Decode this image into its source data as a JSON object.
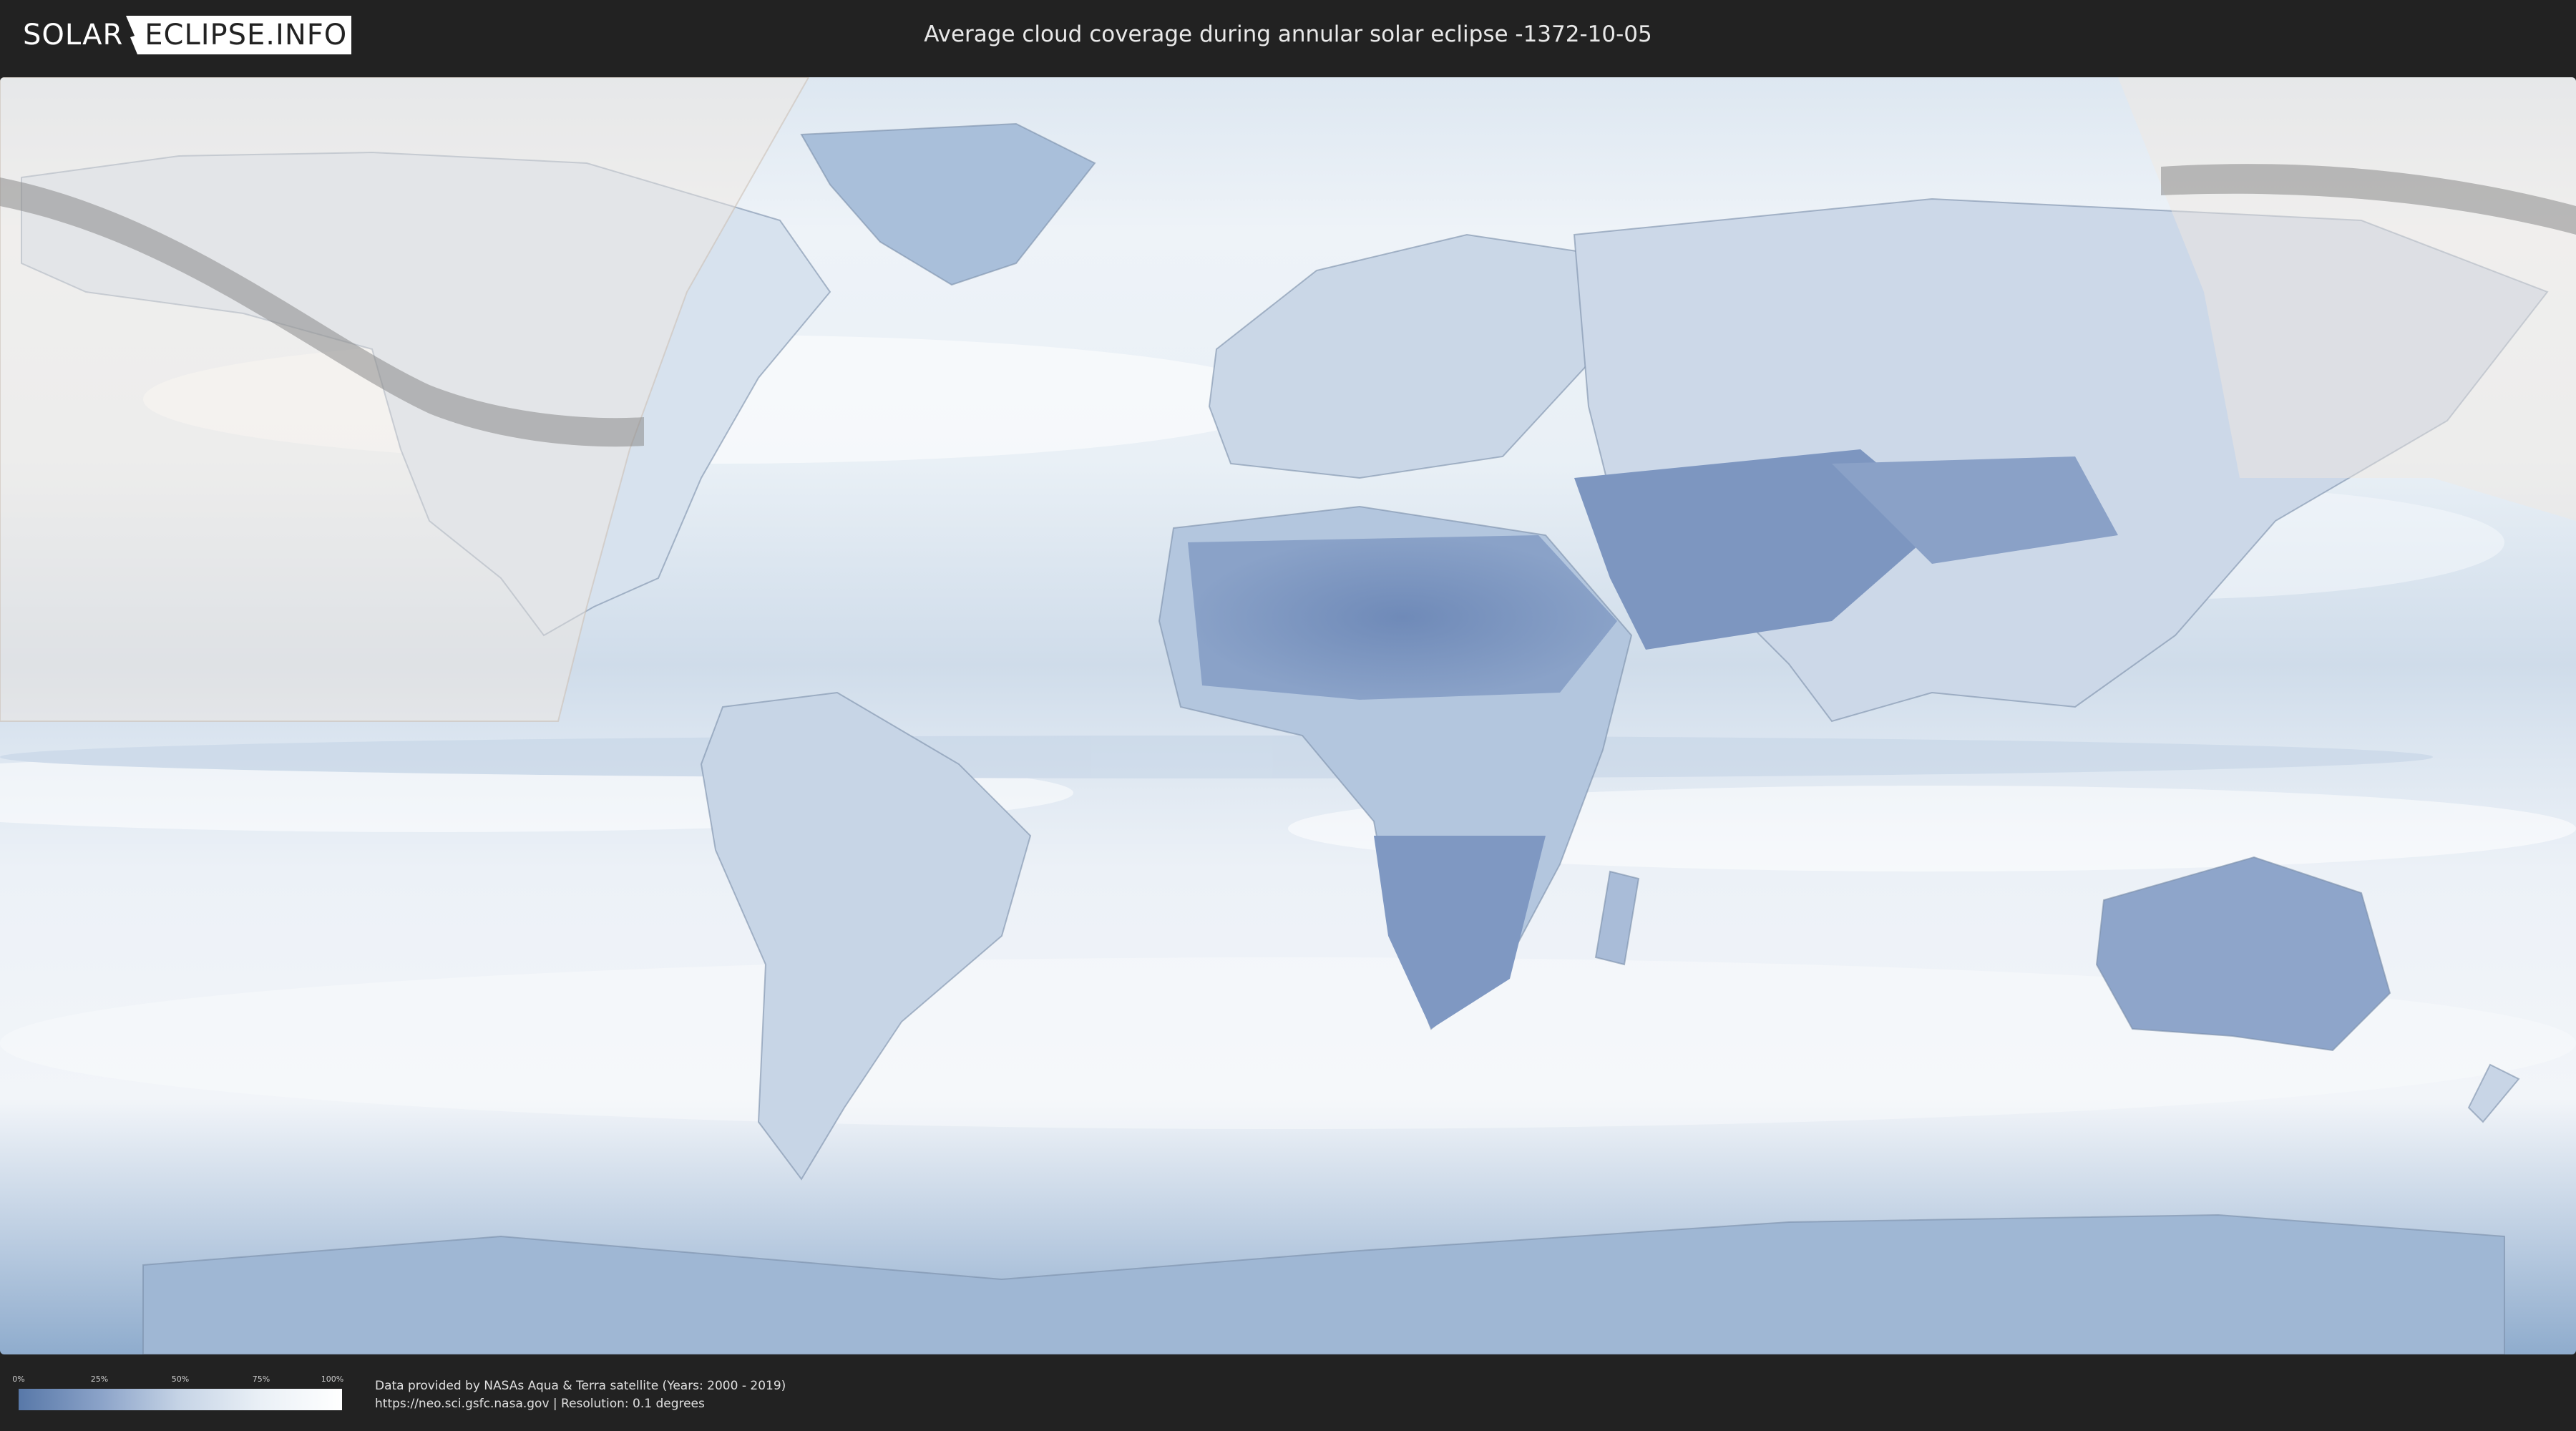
{
  "header": {
    "logo_part1": "SOLAR",
    "logo_part2": "ECLIPSE.INFO",
    "title": "Average cloud coverage during annular solar eclipse -1372-10-05"
  },
  "legend": {
    "ticks": [
      "0%",
      "25%",
      "50%",
      "75%",
      "100%"
    ],
    "scale_values": [
      0,
      25,
      50,
      75,
      100
    ],
    "gradient_colors": [
      "#5878a8",
      "#8aa2c8",
      "#c6d4e6",
      "#eaf0f6",
      "#ffffff"
    ]
  },
  "credits": {
    "line1": "Data provided by NASAs Aqua & Terra satellite (Years: 2000 - 2019)",
    "line2": "https://neo.sci.gsfc.nasa.gov | Resolution: 0.1 degrees"
  },
  "map": {
    "icons": [
      "world-map",
      "eclipse-path-band",
      "night-shadow-left",
      "night-shadow-right"
    ],
    "colors": {
      "ocean_cloud": "#e6edf5",
      "clear_land": "#6f8ab8",
      "heavy_cloud": "#ffffff",
      "eclipse_path": "#8a8a8a",
      "night_overlay": "#f2e8e0"
    }
  }
}
